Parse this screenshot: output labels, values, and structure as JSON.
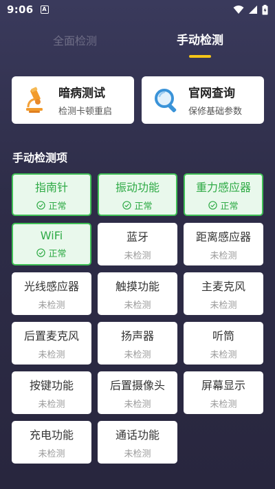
{
  "status_bar": {
    "time": "9:06",
    "notif_glyph": "A",
    "icons": [
      "wifi-icon",
      "signal-icon",
      "battery-icon"
    ]
  },
  "tabs": [
    {
      "label": "全面检测",
      "active": false
    },
    {
      "label": "手动检测",
      "active": true
    }
  ],
  "top_cards": {
    "dark": {
      "title": "暗病测试",
      "subtitle": "检测卡顿重启",
      "icon": "microscope-icon"
    },
    "web": {
      "title": "官网查询",
      "subtitle": "保修基础参数",
      "icon": "magnifier-icon"
    }
  },
  "section_title": "手动检测项",
  "items": [
    {
      "name": "指南针",
      "status": "正常",
      "ok": true
    },
    {
      "name": "振动功能",
      "status": "正常",
      "ok": true
    },
    {
      "name": "重力感应器",
      "status": "正常",
      "ok": true
    },
    {
      "name": "WiFi",
      "status": "正常",
      "ok": true
    },
    {
      "name": "蓝牙",
      "status": "未检测",
      "ok": false
    },
    {
      "name": "距离感应器",
      "status": "未检测",
      "ok": false
    },
    {
      "name": "光线感应器",
      "status": "未检测",
      "ok": false
    },
    {
      "name": "触摸功能",
      "status": "未检测",
      "ok": false
    },
    {
      "name": "主麦克风",
      "status": "未检测",
      "ok": false
    },
    {
      "name": "后置麦克风",
      "status": "未检测",
      "ok": false
    },
    {
      "name": "扬声器",
      "status": "未检测",
      "ok": false
    },
    {
      "name": "听筒",
      "status": "未检测",
      "ok": false
    },
    {
      "name": "按键功能",
      "status": "未检测",
      "ok": false
    },
    {
      "name": "后置摄像头",
      "status": "未检测",
      "ok": false
    },
    {
      "name": "屏幕显示",
      "status": "未检测",
      "ok": false
    },
    {
      "name": "充电功能",
      "status": "未检测",
      "ok": false
    },
    {
      "name": "通话功能",
      "status": "未检测",
      "ok": false
    }
  ],
  "colors": {
    "accent_yellow": "#f5c518",
    "ok_green": "#2eaa45",
    "ok_bg": "#e9f8ec",
    "background": "#2e2d48"
  }
}
